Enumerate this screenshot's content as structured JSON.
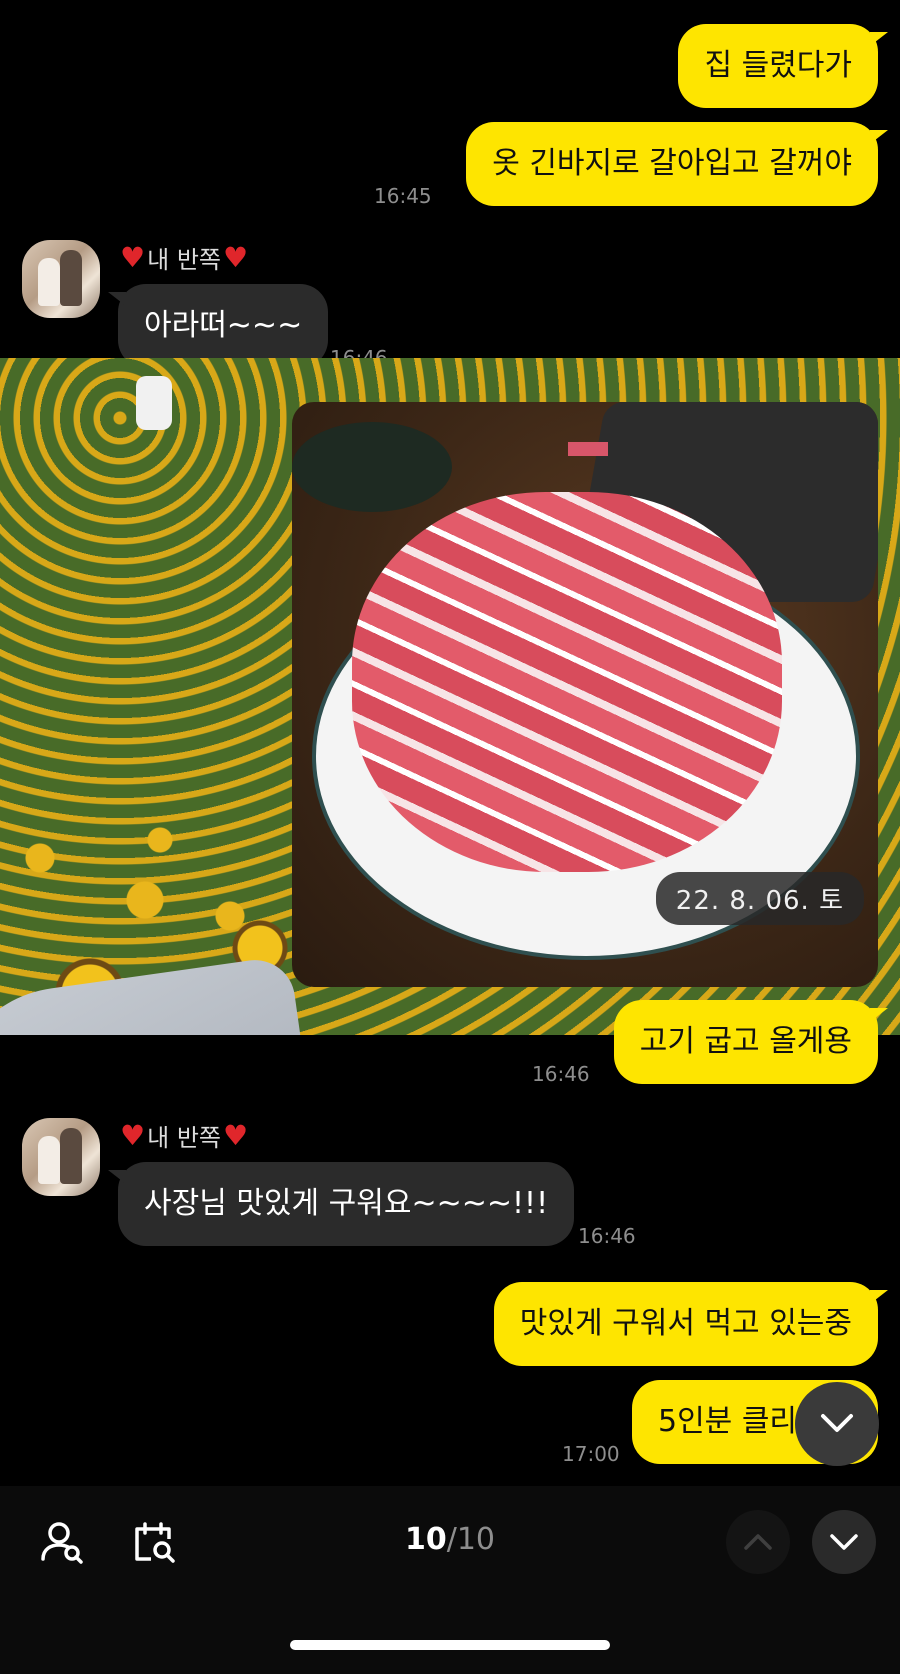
{
  "messages": {
    "m1": {
      "text": "집 들렸다가"
    },
    "m2": {
      "text": "옷 긴바지로 갈아입고 갈꺼야",
      "time": "16:45"
    },
    "m3": {
      "sender": "내 반쪽",
      "text": "아라떠~~~",
      "time": "16:46"
    },
    "m4": {
      "text": "고기 굽고 올게용",
      "time": "16:46"
    },
    "m5": {
      "sender": "내 반쪽",
      "text": "사장님 맛있게 구워요~~~~!!!",
      "time": "16:46"
    },
    "m6": {
      "text": "맛있게 구워서 먹고 있는중"
    },
    "m7": {
      "text": "5인분 클리",
      "time": "17:00"
    }
  },
  "photo": {
    "date_badge": "22. 8. 06. 토"
  },
  "search_bar": {
    "current": "10",
    "separator": "/",
    "total": "10"
  },
  "icons": [
    "share-icon",
    "scroll-down-icon",
    "member-search-icon",
    "date-search-icon",
    "prev-result-icon",
    "next-result-icon"
  ],
  "colors": {
    "my_bubble": "#fee500",
    "other_bubble": "#2b2b2b",
    "background": "#000000",
    "heart": "#e0262b"
  }
}
